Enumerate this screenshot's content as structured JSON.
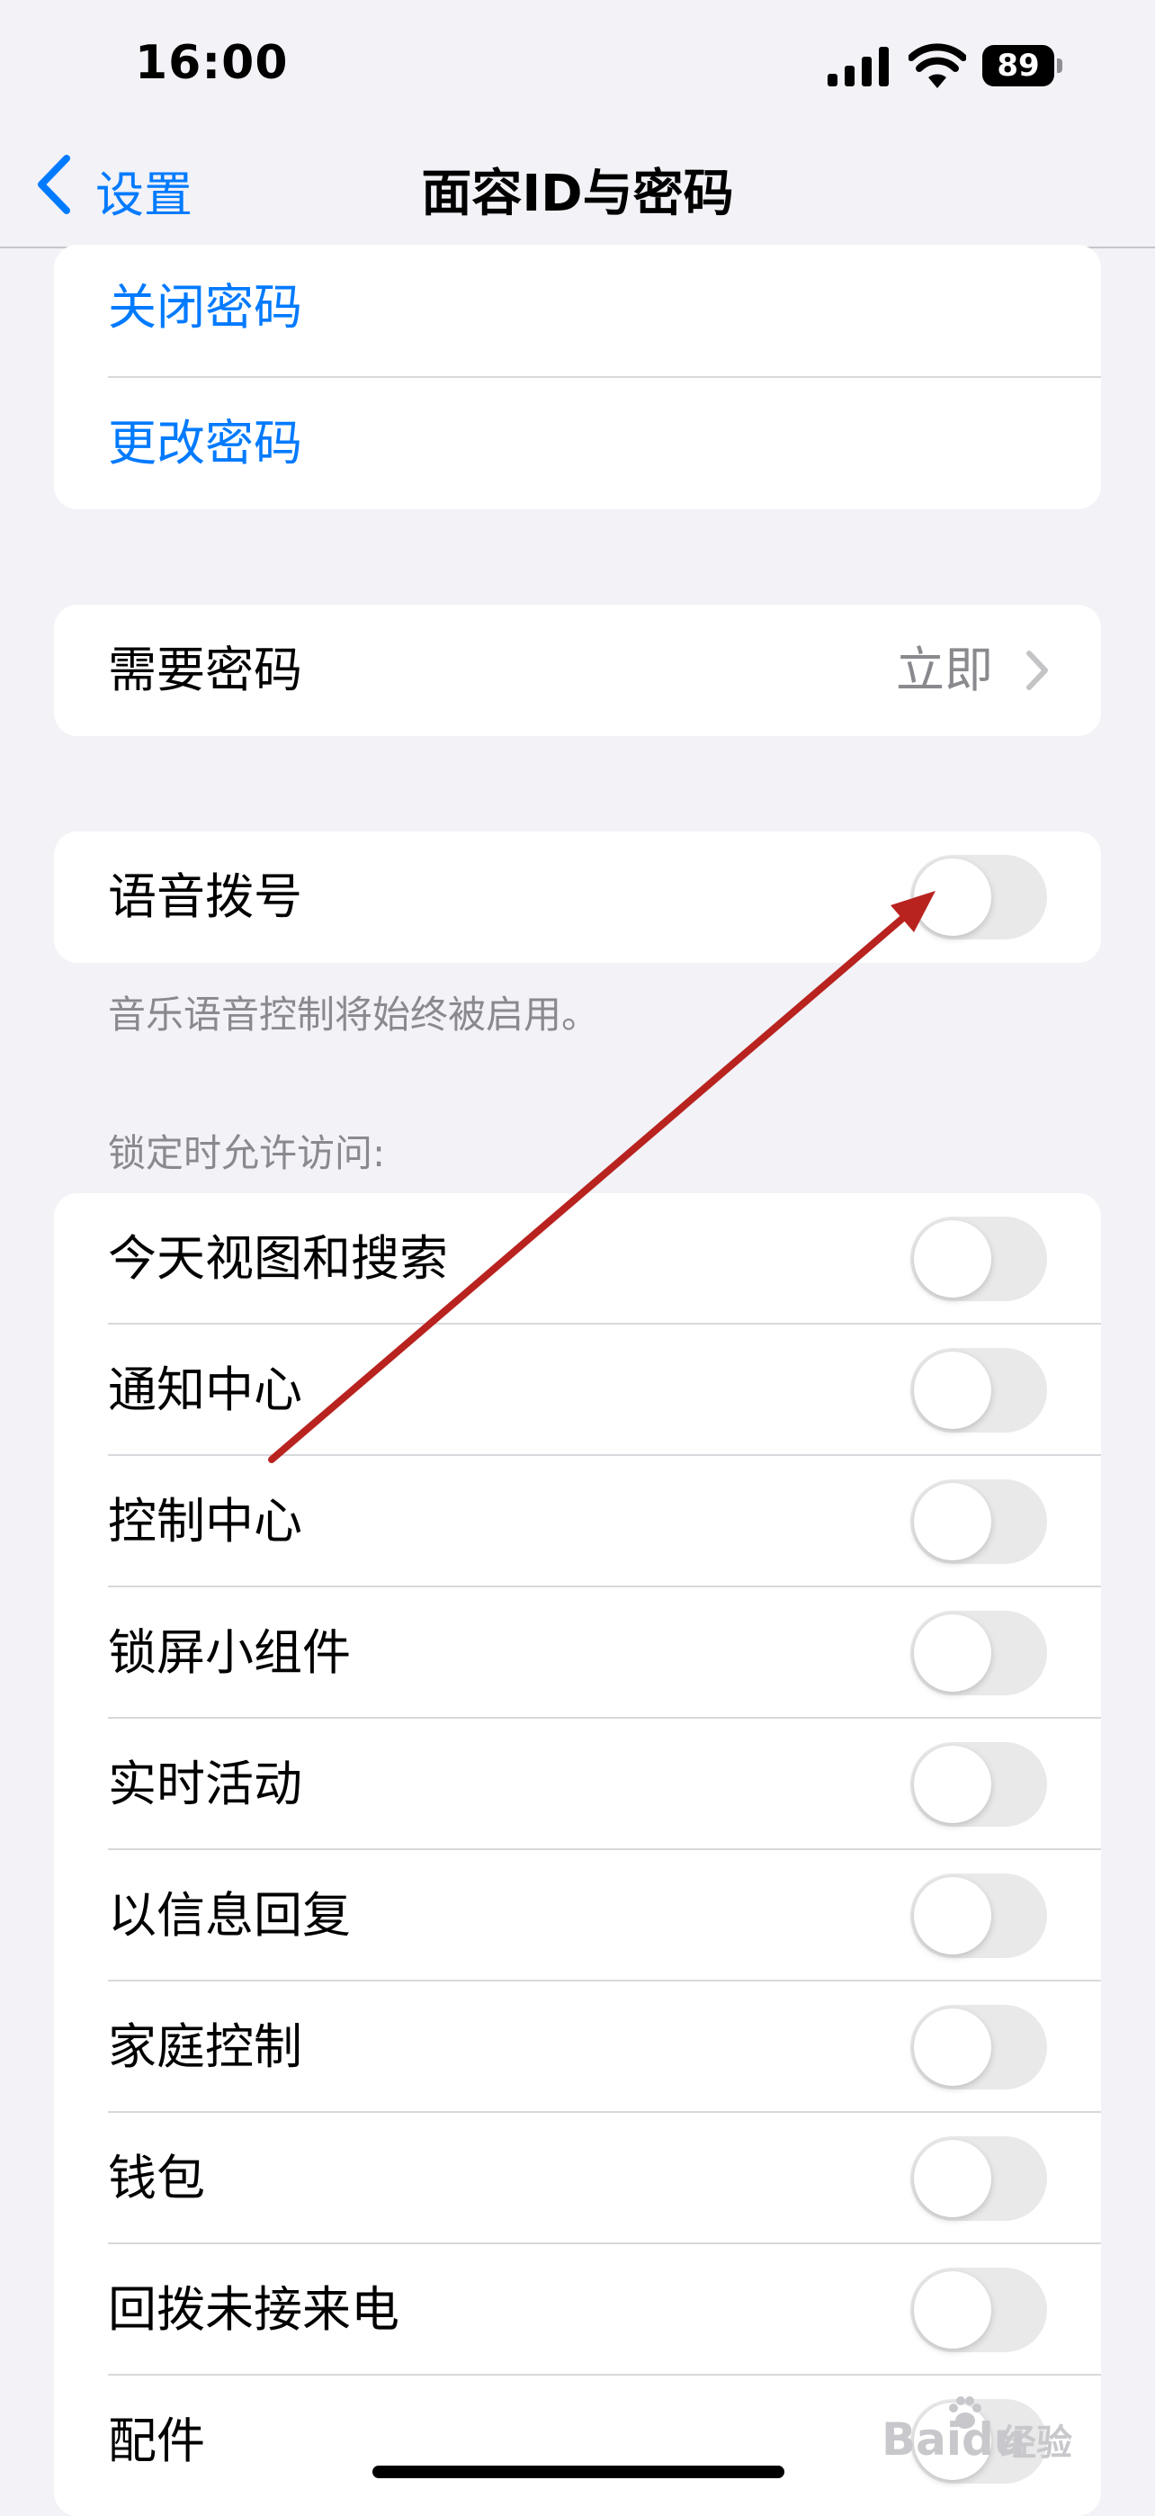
{
  "status_bar": {
    "time": "16:00",
    "battery": "89"
  },
  "nav": {
    "back_label": "设置",
    "title": "面容ID与密码"
  },
  "passcode_group": {
    "turn_off": "关闭密码",
    "change": "更改密码"
  },
  "require_passcode": {
    "label": "需要密码",
    "value": "立即"
  },
  "voice_dial": {
    "label": "语音拨号",
    "on": false,
    "footnote": "音乐语音控制将始终被启用。"
  },
  "lock_access": {
    "header": "锁定时允许访问:",
    "items": [
      {
        "label": "今天视图和搜索",
        "on": false
      },
      {
        "label": "通知中心",
        "on": false
      },
      {
        "label": "控制中心",
        "on": false
      },
      {
        "label": "锁屏小组件",
        "on": false
      },
      {
        "label": "实时活动",
        "on": false
      },
      {
        "label": "以信息回复",
        "on": false
      },
      {
        "label": "家庭控制",
        "on": false
      },
      {
        "label": "钱包",
        "on": false
      },
      {
        "label": "回拨未接来电",
        "on": false
      },
      {
        "label": "配件",
        "on": false
      }
    ]
  },
  "annotation": {
    "color": "#b8231f"
  },
  "watermark": {
    "brand": "Baidu",
    "sub": "经验"
  },
  "colors": {
    "accent": "#007aff",
    "background": "#f2f2f7",
    "toggle_off": "#e9e9ea"
  }
}
